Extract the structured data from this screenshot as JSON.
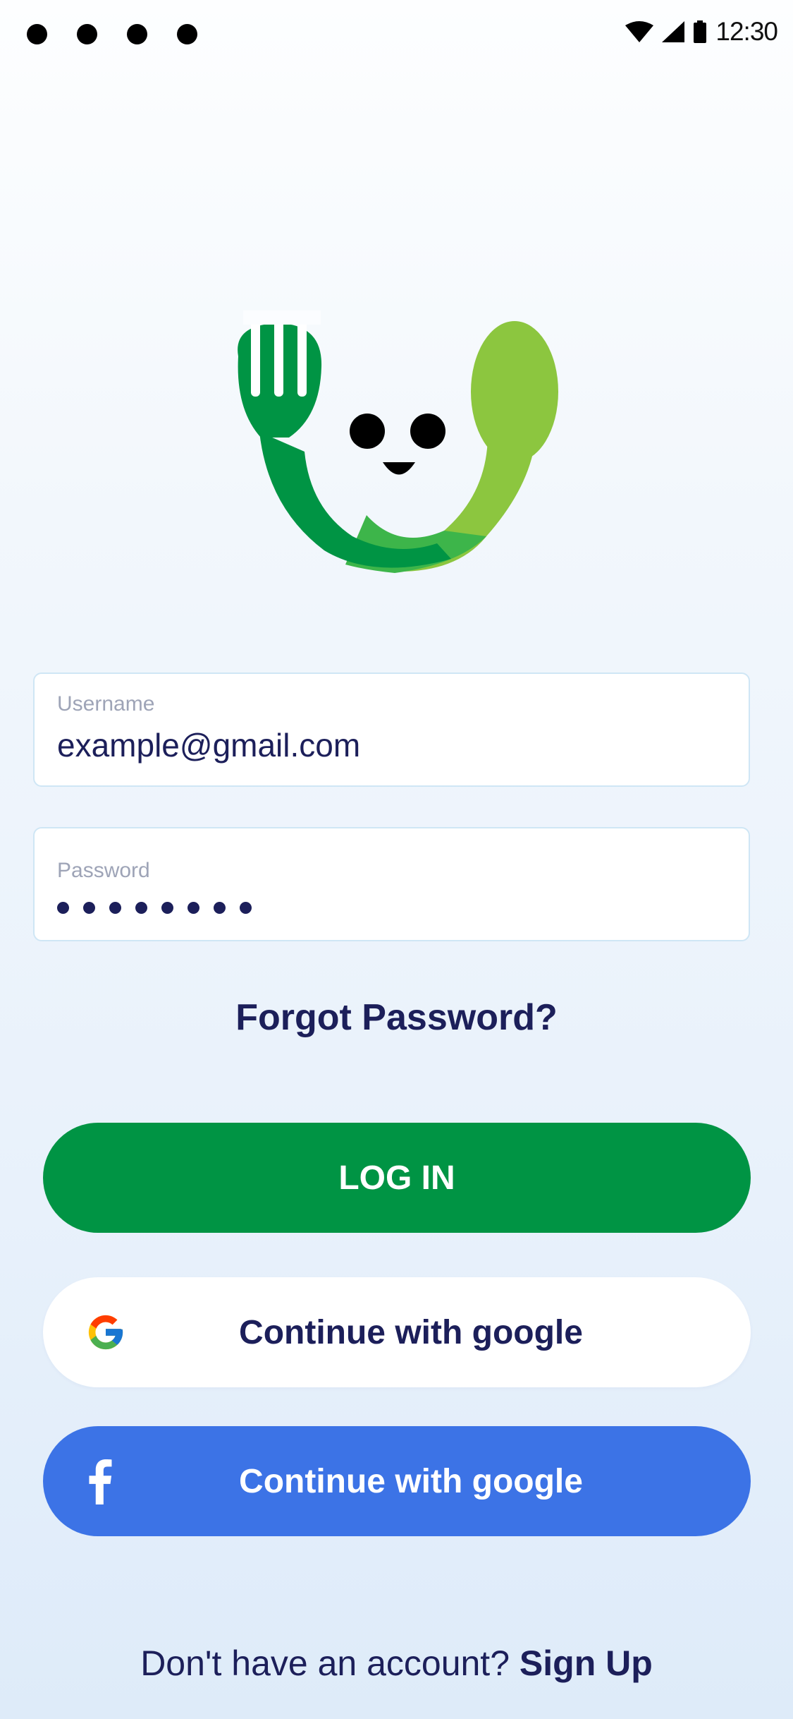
{
  "status_bar": {
    "time": "12:30",
    "icons": [
      "notification-dot",
      "notification-dot",
      "notification-dot",
      "notification-dot",
      "wifi-icon",
      "signal-icon",
      "battery-icon"
    ]
  },
  "logo": {
    "icon": "fork-spoon-smile-logo",
    "colors": {
      "dark_green": "#009444",
      "mid_green": "#3db54a",
      "light_green": "#8cc63f"
    }
  },
  "form": {
    "username": {
      "label": "Username",
      "value": "example@gmail.com"
    },
    "password": {
      "label": "Password",
      "masked_length": 8
    },
    "forgot_password": "Forgot Password?"
  },
  "buttons": {
    "login": "LOG IN",
    "google": "Continue with google",
    "facebook": "Continue with google"
  },
  "footer": {
    "prompt": "Don't  have an account?",
    "signup": "Sign Up"
  },
  "colors": {
    "primary_green": "#009444",
    "facebook_blue": "#3c73e6",
    "text_navy": "#1c1f5a"
  }
}
